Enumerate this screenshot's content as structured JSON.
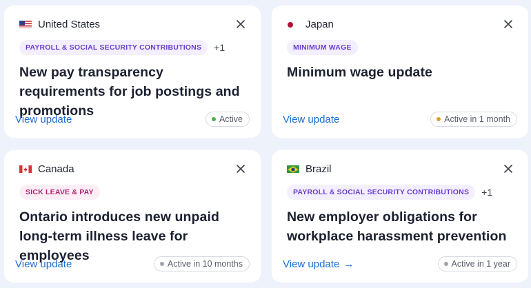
{
  "cards": [
    {
      "country": "United States",
      "flag": "us-flag-icon",
      "tags": [
        "PAYROLL & SOCIAL SECURITY CONTRIBUTIONS"
      ],
      "more": "+1",
      "title": "New pay transparency requirements for job postings and promotions",
      "link": "View update",
      "status": "Active",
      "status_color": "#4caf50"
    },
    {
      "country": "Japan",
      "flag": "japan-flag-icon",
      "tags": [
        "MINIMUM WAGE"
      ],
      "more": "",
      "title": "Minimum wage update",
      "link": "View update",
      "status": "Active in 1 month",
      "status_color": "#e0a020"
    },
    {
      "country": "Canada",
      "flag": "canada-flag-icon",
      "tags": [
        "SICK LEAVE & PAY"
      ],
      "more": "",
      "title": "Ontario introduces new unpaid long-term illness leave for employees",
      "link": "View update",
      "status": "Active in 10 months",
      "status_color": "#a0a4ad"
    },
    {
      "country": "Brazil",
      "flag": "brazil-flag-icon",
      "tags": [
        "PAYROLL & SOCIAL SECURITY CONTRIBUTIONS"
      ],
      "more": "+1",
      "title": "New employer obligations for workplace harassment prevention",
      "link": "View update",
      "link_arrow": "→",
      "status": "Active in 1 year",
      "status_color": "#a0a4ad"
    }
  ]
}
